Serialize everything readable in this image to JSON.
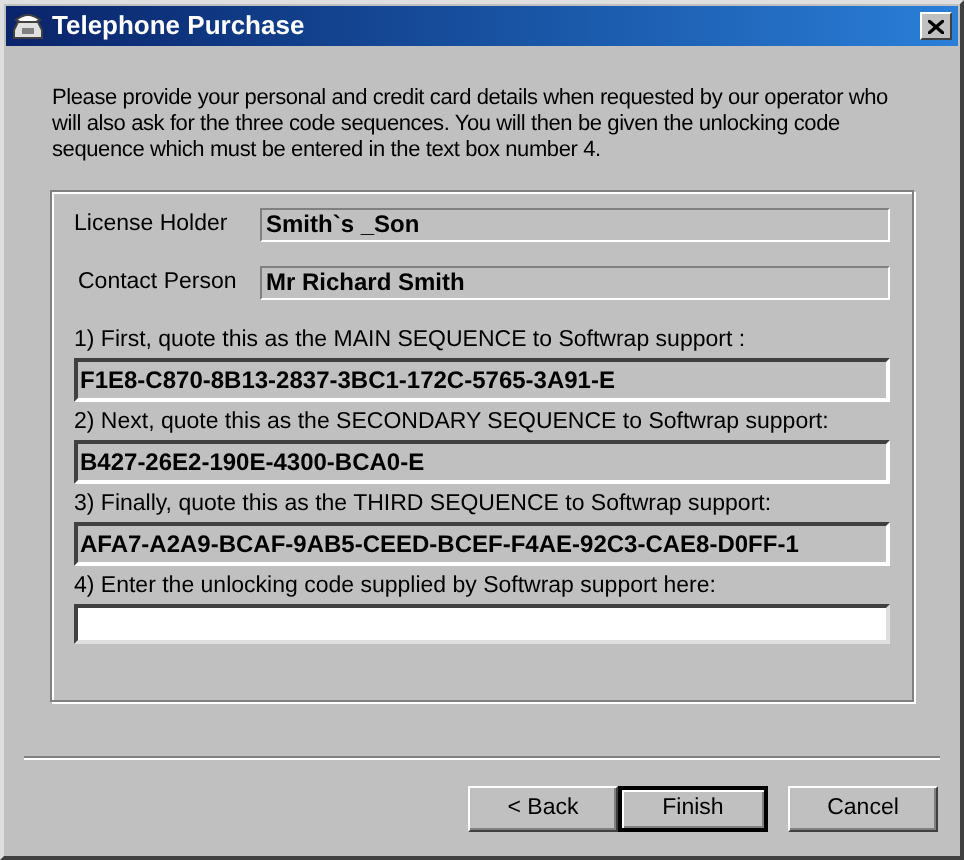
{
  "window": {
    "title": "Telephone Purchase"
  },
  "intro": "Please provide your personal and credit card details when requested by our operator who will also ask for the three code sequences. You will then be given the unlocking code sequence which must be entered in the text box number 4.",
  "details": [
    {
      "label": "License Holder",
      "value": "Smith`s _Son"
    },
    {
      "label": "Contact Person",
      "value": "Mr Richard Smith"
    }
  ],
  "sequences": [
    {
      "label": "1) First, quote this as the MAIN SEQUENCE to Softwrap support :",
      "value": "F1E8-C870-8B13-2837-3BC1-172C-5765-3A91-E",
      "kind": "readonly"
    },
    {
      "label": "2) Next, quote this as the SECONDARY SEQUENCE to Softwrap support:",
      "value": "B427-26E2-190E-4300-BCA0-E",
      "kind": "readonly"
    },
    {
      "label": "3) Finally, quote this as the THIRD SEQUENCE to Softwrap support:",
      "value": "AFA7-A2A9-BCAF-9AB5-CEED-BCEF-F4AE-92C3-CAE8-D0FF-1",
      "kind": "readonly"
    },
    {
      "label": "4) Enter the unlocking code supplied by Softwrap support here:",
      "kind": "input"
    }
  ],
  "buttons": [
    {
      "label": "< Back",
      "default": false
    },
    {
      "label": "Finish",
      "default": true
    },
    {
      "label": "Cancel",
      "default": false
    }
  ]
}
